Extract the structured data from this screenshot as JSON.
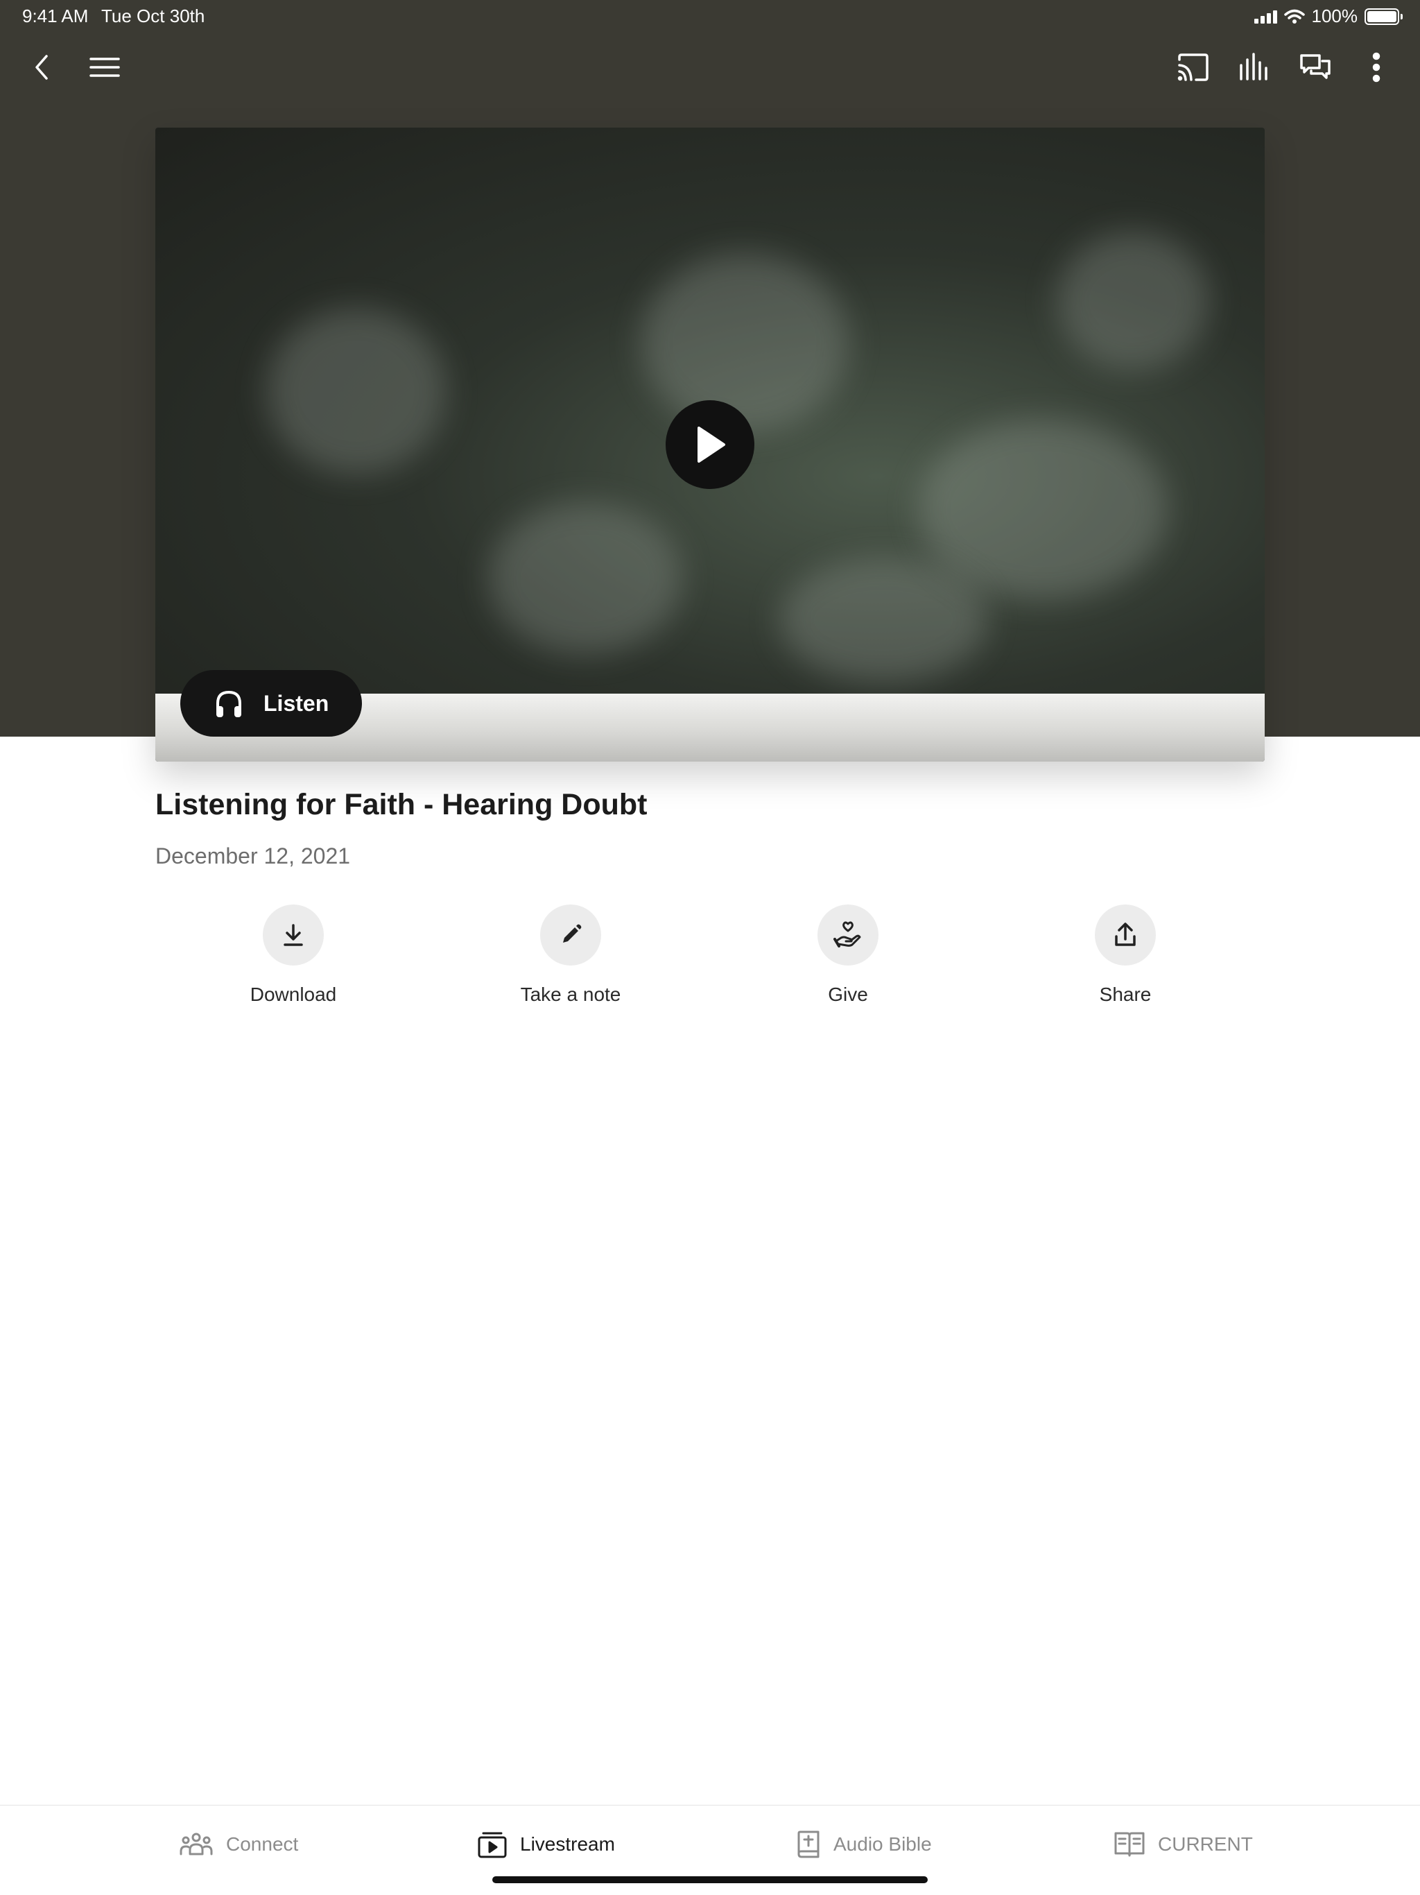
{
  "status_bar": {
    "time": "9:41 AM",
    "date": "Tue Oct 30th",
    "battery": "100%"
  },
  "toolbar": {
    "icons": [
      "back-icon",
      "menu-icon",
      "cast-icon",
      "audio-levels-icon",
      "chat-icon",
      "more-icon"
    ]
  },
  "media": {
    "listen_label": "Listen",
    "colors": {
      "background": "#3b3a33",
      "button": "#151515"
    }
  },
  "sermon": {
    "title": "Listening for Faith - Hearing Doubt",
    "date": "December 12, 2021"
  },
  "actions": [
    {
      "label": "Download",
      "icon": "download-icon"
    },
    {
      "label": "Take a note",
      "icon": "pencil-icon"
    },
    {
      "label": "Give",
      "icon": "give-hand-heart-icon"
    },
    {
      "label": "Share",
      "icon": "share-icon"
    }
  ],
  "tabs": [
    {
      "label": "Connect",
      "icon": "people-icon",
      "active": false
    },
    {
      "label": "Livestream",
      "icon": "livestream-icon",
      "active": true
    },
    {
      "label": "Audio Bible",
      "icon": "bible-icon",
      "active": false
    },
    {
      "label": "CURRENT",
      "icon": "book-open-icon",
      "active": false
    }
  ]
}
